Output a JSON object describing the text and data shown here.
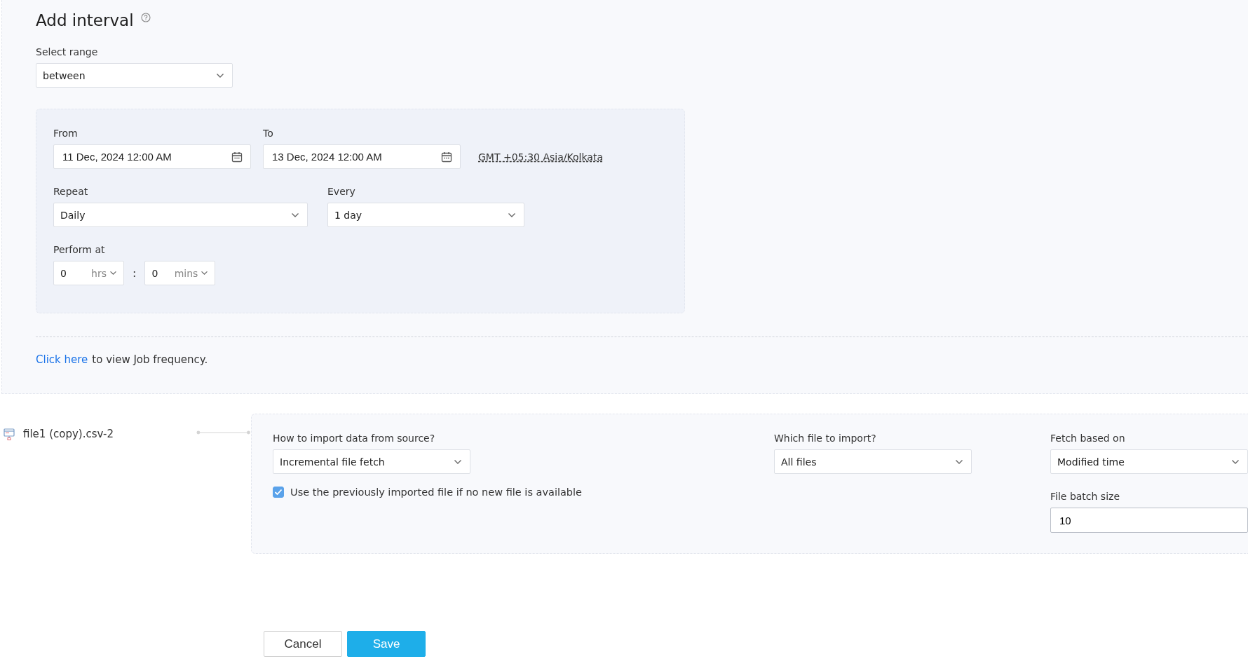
{
  "title": "Add interval",
  "select_range": {
    "label": "Select range",
    "value": "between"
  },
  "from": {
    "label": "From",
    "value": "11 Dec, 2024 12:00 AM"
  },
  "to": {
    "label": "To",
    "value": "13 Dec, 2024 12:00 AM"
  },
  "timezone": "GMT +05:30 Asia/Kolkata",
  "repeat": {
    "label": "Repeat",
    "value": "Daily"
  },
  "every": {
    "label": "Every",
    "value": "1 day"
  },
  "perform_at": {
    "label": "Perform at",
    "hours": {
      "value": "0",
      "unit": "hrs"
    },
    "separator": ":",
    "minutes": {
      "value": "0",
      "unit": "mins"
    }
  },
  "job_frequency": {
    "link": "Click here",
    "text": "to view Job frequency."
  },
  "source": {
    "name": "file1 (copy).csv-2"
  },
  "import_method": {
    "label": "How to import data from source?",
    "value": "Incremental file fetch"
  },
  "use_previous": {
    "label": "Use the previously imported file if no new file is available",
    "checked": true
  },
  "which_file": {
    "label": "Which file to import?",
    "value": "All files"
  },
  "fetch_based_on": {
    "label": "Fetch based on",
    "value": "Modified time"
  },
  "batch_size": {
    "label": "File batch size",
    "value": "10"
  },
  "buttons": [
    {
      "label": "Cancel",
      "kind": "secondary"
    },
    {
      "label": "Save",
      "kind": "primary"
    }
  ]
}
